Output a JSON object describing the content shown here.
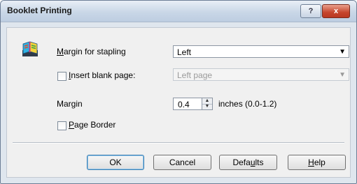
{
  "window": {
    "title": "Booklet Printing",
    "help_glyph": "?",
    "close_glyph": "x"
  },
  "form": {
    "margin_for_stapling": {
      "label_first": "M",
      "label_rest": "argin for stapling",
      "value": "Left"
    },
    "insert_blank_page": {
      "label_first": "I",
      "label_rest": "nsert blank page:",
      "checked": false,
      "value": "Left page"
    },
    "margin": {
      "label_pre": "Mar",
      "label_u": "g",
      "label_post": "in",
      "value": "0.4",
      "units": "inches (0.0-1.2)"
    },
    "page_border": {
      "label_first": "P",
      "label_rest": "age Border",
      "checked": false
    }
  },
  "buttons": {
    "ok": "OK",
    "cancel": "Cancel",
    "defaults_pre": "Defa",
    "defaults_u": "u",
    "defaults_post": "lts",
    "help_u": "H",
    "help_rest": "elp"
  },
  "icons": {
    "app": "booklet-icon",
    "dropdown": "chevron-down-icon",
    "spin_up": "spin-up-icon",
    "spin_down": "spin-down-icon"
  }
}
